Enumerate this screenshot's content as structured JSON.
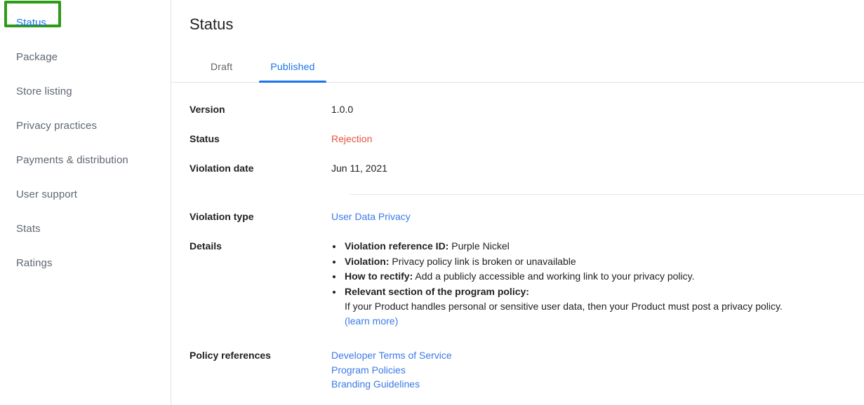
{
  "sidebar": {
    "items": [
      {
        "label": "Status",
        "active": true
      },
      {
        "label": "Package",
        "active": false
      },
      {
        "label": "Store listing",
        "active": false
      },
      {
        "label": "Privacy practices",
        "active": false
      },
      {
        "label": "Payments & distribution",
        "active": false
      },
      {
        "label": "User support",
        "active": false
      },
      {
        "label": "Stats",
        "active": false
      },
      {
        "label": "Ratings",
        "active": false
      }
    ],
    "highlight_color": "#2e9b17"
  },
  "main": {
    "title": "Status",
    "tabs": [
      {
        "label": "Draft",
        "selected": false
      },
      {
        "label": "Published",
        "selected": true
      }
    ],
    "fields": {
      "version_label": "Version",
      "version_value": "1.0.0",
      "status_label": "Status",
      "status_value": "Rejection",
      "status_color": "#e2553d",
      "violation_date_label": "Violation date",
      "violation_date_value": "Jun 11, 2021",
      "violation_type_label": "Violation type",
      "violation_type_value": "User Data Privacy",
      "details_label": "Details",
      "policy_references_label": "Policy references"
    },
    "details_bullets": [
      {
        "term": "Violation reference ID:",
        "text": " Purple Nickel"
      },
      {
        "term": "Violation:",
        "text": " Privacy policy link is broken or unavailable"
      },
      {
        "term": "How to rectify:",
        "text": " Add a publicly accessible and working link to your privacy policy."
      },
      {
        "term": "Relevant section of the program policy:",
        "text": ""
      }
    ],
    "details_paragraph": "If your Product handles personal or sensitive user data, then your Product must post a privacy policy.",
    "details_learn_more": "(learn more)",
    "policy_references": [
      "Developer Terms of Service",
      "Program Policies",
      "Branding Guidelines"
    ],
    "link_color": "#3b7ae8",
    "accent_color": "#1a73e8"
  }
}
